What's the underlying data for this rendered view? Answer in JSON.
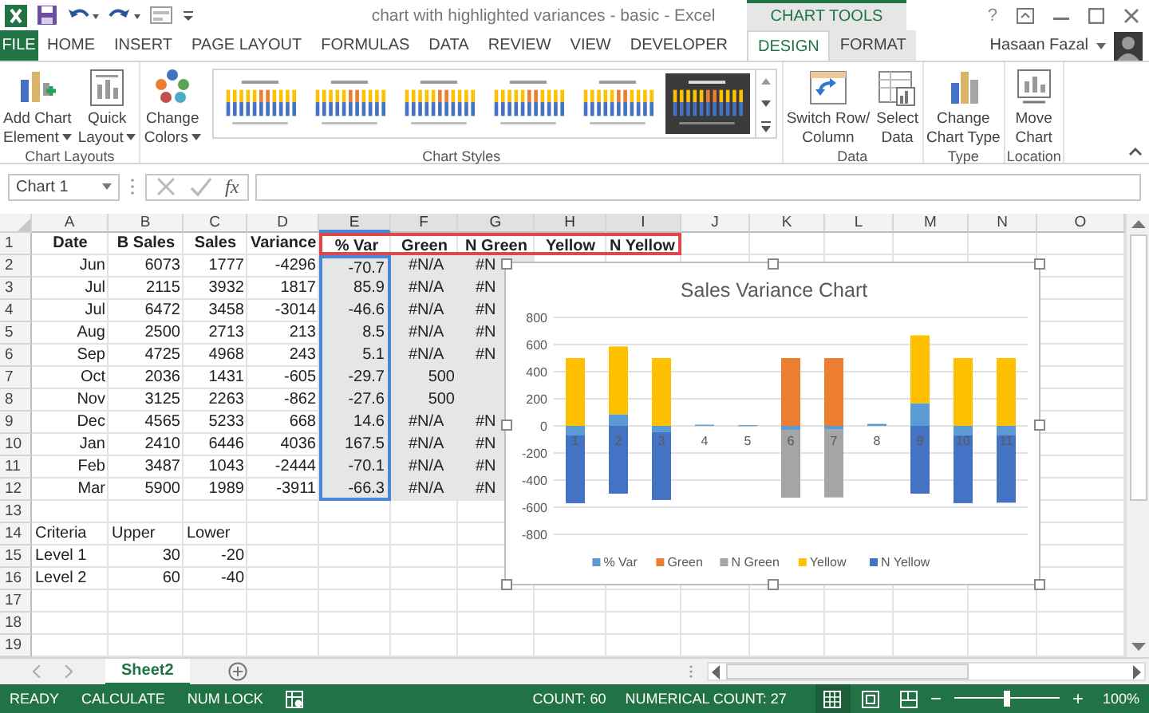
{
  "title_bar": {
    "title": "chart with highlighted variances - basic - Excel",
    "context_label": "CHART TOOLS",
    "help": "?"
  },
  "tabs": [
    {
      "label": "FILE",
      "kind": "file",
      "selected": false
    },
    {
      "label": "HOME",
      "kind": "normal",
      "selected": false
    },
    {
      "label": "INSERT",
      "kind": "normal",
      "selected": false
    },
    {
      "label": "PAGE LAYOUT",
      "kind": "normal",
      "selected": false
    },
    {
      "label": "FORMULAS",
      "kind": "normal",
      "selected": false
    },
    {
      "label": "DATA",
      "kind": "normal",
      "selected": false
    },
    {
      "label": "REVIEW",
      "kind": "normal",
      "selected": false
    },
    {
      "label": "VIEW",
      "kind": "normal",
      "selected": false
    },
    {
      "label": "DEVELOPER",
      "kind": "normal",
      "selected": false
    },
    {
      "label": "DESIGN",
      "kind": "contextual",
      "selected": true
    },
    {
      "label": "FORMAT",
      "kind": "contextual",
      "selected": false
    }
  ],
  "user": {
    "name": "Hasaan Fazal"
  },
  "ribbon": {
    "groups": [
      {
        "label": "Chart Layouts",
        "items": [
          {
            "kind": "add-element",
            "lines": [
              "Add Chart",
              "Element"
            ],
            "dropdown": true
          },
          {
            "kind": "quick-layout",
            "lines": [
              "Quick",
              "Layout"
            ],
            "dropdown": true
          }
        ]
      },
      {
        "label": "Chart Styles",
        "items": [
          {
            "kind": "colors",
            "lines": [
              "Change",
              "Colors"
            ],
            "dropdown": true
          },
          {
            "kind": "gallery",
            "styles": [
              {
                "kind": "light"
              },
              {
                "kind": "light"
              },
              {
                "kind": "light"
              },
              {
                "kind": "light"
              },
              {
                "kind": "light"
              },
              {
                "kind": "dark"
              }
            ]
          }
        ]
      },
      {
        "label": "Data",
        "items": [
          {
            "kind": "switch",
            "lines": [
              "Switch Row/",
              "Column"
            ],
            "dropdown": false
          },
          {
            "kind": "select-data",
            "lines": [
              "Select",
              "Data"
            ],
            "dropdown": false
          }
        ]
      },
      {
        "label": "Type",
        "items": [
          {
            "kind": "change-type",
            "lines": [
              "Change",
              "Chart Type"
            ],
            "dropdown": false
          }
        ]
      },
      {
        "label": "Location",
        "items": [
          {
            "kind": "move",
            "lines": [
              "Move",
              "Chart"
            ],
            "dropdown": false
          }
        ]
      }
    ]
  },
  "formula_bar": {
    "name_box": "Chart 1",
    "fx": "fx"
  },
  "sheet": {
    "columns": [
      {
        "label": "A",
        "series": false,
        "values": false
      },
      {
        "label": "B",
        "series": false,
        "values": false
      },
      {
        "label": "C",
        "series": false,
        "values": false
      },
      {
        "label": "D",
        "series": false,
        "values": false
      },
      {
        "label": "E",
        "series": true,
        "values": true
      },
      {
        "label": "F",
        "series": true,
        "values": false
      },
      {
        "label": "G",
        "series": true,
        "values": false
      },
      {
        "label": "H",
        "series": true,
        "values": false
      },
      {
        "label": "I",
        "series": true,
        "values": false
      },
      {
        "label": "J",
        "series": false,
        "values": false
      },
      {
        "label": "K",
        "series": false,
        "values": false
      },
      {
        "label": "L",
        "series": false,
        "values": false
      },
      {
        "label": "M",
        "series": false,
        "values": false
      },
      {
        "label": "N",
        "series": false,
        "values": false
      },
      {
        "label": "O",
        "series": false,
        "values": false
      }
    ],
    "rows": [
      {
        "label": "1",
        "kind": "header",
        "in_range": false,
        "cells": [
          "Date",
          "B Sales",
          "Sales",
          "Variance",
          "% Var",
          "Green",
          "N Green",
          "Yellow",
          "N Yellow"
        ]
      },
      {
        "label": "2",
        "kind": "data",
        "in_range": true,
        "cells": [
          "Jun",
          "6073",
          "1777",
          "-4296",
          "-70.7",
          {
            "text": "#N/A",
            "kind": "error"
          },
          {
            "text": "#N",
            "kind": "error"
          }
        ]
      },
      {
        "label": "3",
        "kind": "data",
        "in_range": true,
        "cells": [
          "Jul",
          "2115",
          "3932",
          "1817",
          "85.9",
          {
            "text": "#N/A",
            "kind": "error"
          },
          {
            "text": "#N",
            "kind": "error"
          }
        ]
      },
      {
        "label": "4",
        "kind": "data",
        "in_range": true,
        "cells": [
          "Jul",
          "6472",
          "3458",
          "-3014",
          "-46.6",
          {
            "text": "#N/A",
            "kind": "error"
          },
          {
            "text": "#N",
            "kind": "error"
          }
        ]
      },
      {
        "label": "5",
        "kind": "data",
        "in_range": true,
        "cells": [
          "Aug",
          "2500",
          "2713",
          "213",
          "8.5",
          {
            "text": "#N/A",
            "kind": "error"
          },
          {
            "text": "#N",
            "kind": "error"
          }
        ]
      },
      {
        "label": "6",
        "kind": "data",
        "in_range": true,
        "cells": [
          "Sep",
          "4725",
          "4968",
          "243",
          "5.1",
          {
            "text": "#N/A",
            "kind": "error"
          },
          {
            "text": "#N",
            "kind": "error"
          }
        ]
      },
      {
        "label": "7",
        "kind": "data",
        "in_range": true,
        "cells": [
          "Oct",
          "2036",
          "1431",
          "-605",
          "-29.7",
          "500"
        ]
      },
      {
        "label": "8",
        "kind": "data",
        "in_range": true,
        "cells": [
          "Nov",
          "3125",
          "2263",
          "-862",
          "-27.6",
          "500"
        ]
      },
      {
        "label": "9",
        "kind": "data",
        "in_range": true,
        "cells": [
          "Dec",
          "4565",
          "5233",
          "668",
          "14.6",
          {
            "text": "#N/A",
            "kind": "error"
          },
          {
            "text": "#N",
            "kind": "error"
          }
        ]
      },
      {
        "label": "10",
        "kind": "data",
        "in_range": true,
        "cells": [
          "Jan",
          "2410",
          "6446",
          "4036",
          "167.5",
          {
            "text": "#N/A",
            "kind": "error"
          },
          {
            "text": "#N",
            "kind": "error"
          }
        ]
      },
      {
        "label": "11",
        "kind": "data",
        "in_range": true,
        "cells": [
          "Feb",
          "3487",
          "1043",
          "-2444",
          "-70.1",
          {
            "text": "#N/A",
            "kind": "error"
          },
          {
            "text": "#N",
            "kind": "error"
          }
        ]
      },
      {
        "label": "12",
        "kind": "data",
        "in_range": true,
        "cells": [
          "Mar",
          "5900",
          "1989",
          "-3911",
          "-66.3",
          {
            "text": "#N/A",
            "kind": "error"
          },
          {
            "text": "#N",
            "kind": "error"
          }
        ]
      },
      {
        "label": "13",
        "kind": "data",
        "in_range": false
      },
      {
        "label": "14",
        "kind": "data",
        "in_range": false,
        "cells": [
          {
            "text": "Criteria",
            "kind": "label"
          },
          {
            "text": "Upper",
            "kind": "label"
          },
          {
            "text": "Lower",
            "kind": "label"
          }
        ]
      },
      {
        "label": "15",
        "kind": "data",
        "in_range": false,
        "cells": [
          {
            "text": "Level 1",
            "kind": "label"
          },
          "30",
          "-20"
        ]
      },
      {
        "label": "16",
        "kind": "data",
        "in_range": false,
        "cells": [
          {
            "text": "Level 2",
            "kind": "label"
          },
          "60",
          "-40"
        ]
      },
      {
        "label": "17",
        "kind": "data",
        "in_range": false
      },
      {
        "label": "18",
        "kind": "data",
        "in_range": false
      },
      {
        "label": "19",
        "kind": "data",
        "in_range": false
      }
    ]
  },
  "chart": {
    "chart_data": {
      "type": "bar",
      "title": "Sales Variance Chart",
      "categories": [
        "1",
        "2",
        "3",
        "4",
        "5",
        "6",
        "7",
        "8",
        "9",
        "10",
        "11"
      ],
      "stacked": true,
      "grid": true,
      "legend": true,
      "ylim": [
        -800,
        800
      ],
      "yticks": [
        -800,
        -600,
        -400,
        -200,
        0,
        200,
        400,
        600,
        800
      ],
      "series": [
        {
          "name": "% Var",
          "color": "#5b9bd5",
          "values": [
            -70.7,
            85.9,
            -46.6,
            8.5,
            5.1,
            -29.7,
            -27.6,
            14.6,
            167.5,
            -70.1,
            -66.3
          ]
        },
        {
          "name": "Green",
          "color": "#ed7d31",
          "values": [
            null,
            null,
            null,
            null,
            null,
            500,
            500,
            null,
            null,
            null,
            null
          ]
        },
        {
          "name": "N Green",
          "color": "#a5a5a5",
          "values": [
            null,
            null,
            null,
            null,
            null,
            -500,
            -500,
            null,
            null,
            null,
            null
          ]
        },
        {
          "name": "Yellow",
          "color": "#ffc000",
          "values": [
            500,
            500,
            500,
            null,
            null,
            null,
            null,
            null,
            500,
            500,
            500
          ]
        },
        {
          "name": "N Yellow",
          "color": "#4472c4",
          "values": [
            -500,
            -500,
            -500,
            null,
            null,
            null,
            null,
            null,
            -500,
            -500,
            -500
          ]
        }
      ]
    }
  },
  "sheet_tabs": [
    {
      "label": "Sheet2",
      "selected": true
    }
  ],
  "status_bar": {
    "items": [
      "READY",
      "CALCULATE",
      "NUM LOCK"
    ],
    "count": "COUNT: 60",
    "numerical_count": "NUMERICAL COUNT: 27",
    "views": [
      {
        "kind": "normal",
        "selected": true
      },
      {
        "kind": "page-layout",
        "selected": false
      },
      {
        "kind": "page-break",
        "selected": false
      }
    ],
    "zoom": {
      "minus": "−",
      "plus": "+",
      "level": 0.5,
      "reading": "100%"
    }
  }
}
